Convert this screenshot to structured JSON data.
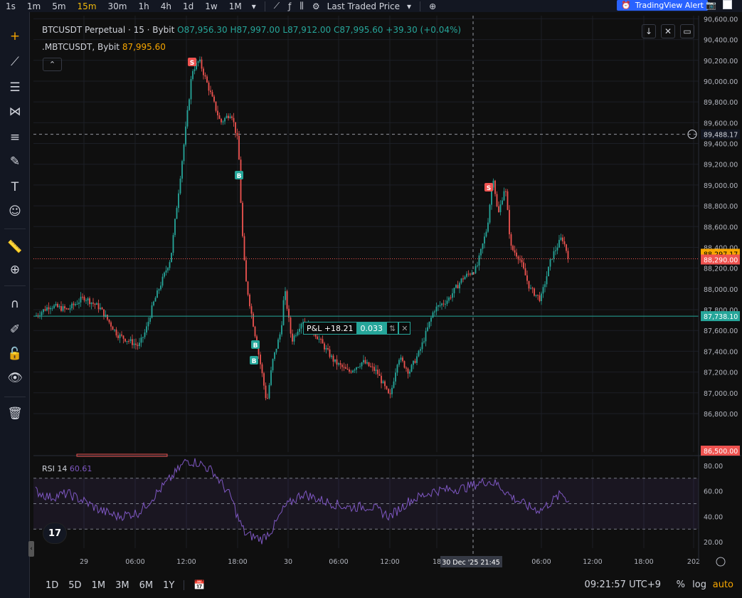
{
  "toolbar": {
    "timeframes": [
      "1s",
      "1m",
      "5m",
      "15m",
      "30m",
      "1h",
      "4h",
      "1d",
      "1w",
      "1M"
    ],
    "active": "15m",
    "price_source": "Last Traded Price",
    "alert_label": "TradingView Alert"
  },
  "legend": {
    "symbol": "BTCUSDT Perpetual · 15 · Bybit",
    "o": "O87,956.30",
    "h": "H87,997.00",
    "l": "L87,912.00",
    "c": "C87,995.60",
    "change": "+39.30 (+0.04%)",
    "mark_symbol": ".MBTCUSDT, Bybit",
    "mark_value": "87,995.60"
  },
  "price_axis": {
    "ticks": [
      "90,600.00",
      "90,400.00",
      "90,200.00",
      "90,000.00",
      "89,800.00",
      "89,600.00",
      "89,400.00",
      "89,200.00",
      "89,000.00",
      "88,800.00",
      "88,600.00",
      "88,400.00",
      "88,200.00",
      "88,000.00",
      "87,800.00",
      "87,600.00",
      "87,400.00",
      "87,200.00",
      "87,000.00",
      "86,800.00"
    ],
    "crosshair_label": "89,488.17",
    "label_orange": "88,297.17",
    "label_red": "88,290.00",
    "label_green": "87,738.10",
    "label_bottom": "86,500.00"
  },
  "time_axis": {
    "ticks": [
      "29",
      "06:00",
      "12:00",
      "18:00",
      "30",
      "06:00",
      "12:00",
      "18",
      "06:00",
      "12:00",
      "18:00",
      "202"
    ],
    "crosshair_label": "30 Dec '25   21:45"
  },
  "position": {
    "pnl": "P&L +18.21",
    "qty": "0.033"
  },
  "rsi": {
    "label": "RSI 14",
    "value": "60.61",
    "ticks": [
      "80.00",
      "60.00",
      "40.00",
      "20.00"
    ]
  },
  "bottom": {
    "ranges": [
      "1D",
      "5D",
      "1M",
      "3M",
      "6M",
      "1Y"
    ],
    "clock": "09:21:57 UTC+9",
    "pct": "%",
    "log": "log",
    "auto": "auto"
  },
  "markers": {
    "sell": "S",
    "buy": "B"
  },
  "colors": {
    "up": "#26a69a",
    "down": "#ef5350",
    "rsi": "#7e57c2",
    "accent": "#f7a600"
  }
}
